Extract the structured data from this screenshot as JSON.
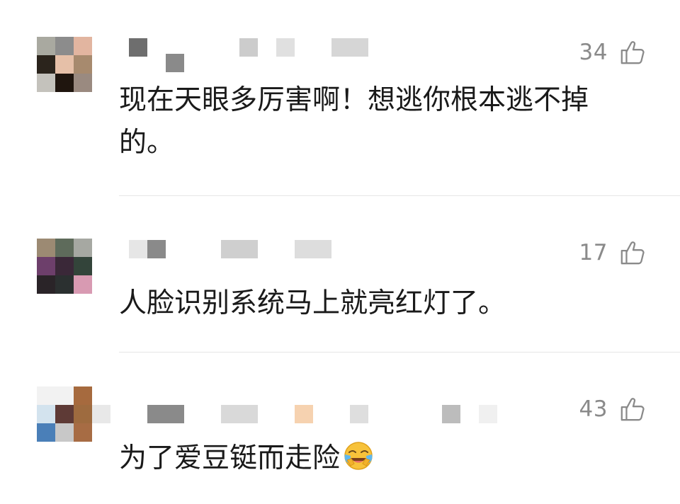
{
  "comments": [
    {
      "likes": "34",
      "text": "现在天眼多厉害啊！想逃你根本逃不掉的。",
      "avatar": [
        "#a9a9a0",
        "#8c8c8c",
        "#e2b5a0",
        "#2b241c",
        "#e6c0a8",
        "#a78a6e",
        "#c4c2bc",
        "#1f150e",
        "#9a8a80"
      ],
      "name_blocks": [
        "#6e6e6e",
        "#cccccc",
        "#e0e0e0",
        "#d6d6d6",
        "#8a8a8a"
      ]
    },
    {
      "likes": "17",
      "text": "人脸识别系统马上就亮红灯了。",
      "avatar": [
        "#9c8a73",
        "#5e6b5b",
        "#a6a8a2",
        "#6d3f6b",
        "#3a2838",
        "#33443a",
        "#2a2428",
        "#2b3030",
        "#d89ab2"
      ],
      "name_blocks": [
        "#8a8a8a",
        "#cfcfcf",
        "#dddddd"
      ]
    },
    {
      "likes": "43",
      "text": "为了爱豆铤而走险",
      "avatar": [
        "#f2f2f2",
        "#f2f2f2",
        "#a66a3e",
        "#d3e3ee",
        "#5e3a36",
        "#9e6b3f",
        "#4a7fb8",
        "#c8c8c8",
        "#a76c44"
      ],
      "name_blocks": [
        "#8a8a8a",
        "#d9d9d9",
        "#f6d2b0",
        "#dedede",
        "#bcbcbc"
      ]
    }
  ],
  "icons": {
    "like": "thumbs-up-outline-icon",
    "emoji": "laughing-crying-emoji"
  },
  "colors": {
    "text": "#1a1a1a",
    "like_count": "#8a8a8a",
    "divider": "#e6e6e6"
  }
}
